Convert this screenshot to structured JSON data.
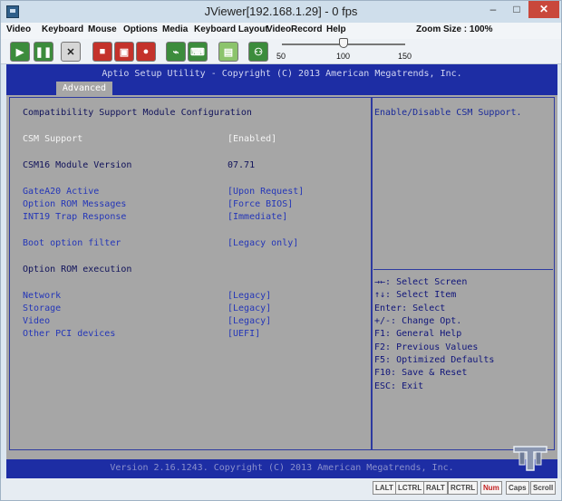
{
  "window": {
    "title": "JViewer[192.168.1.29] - 0 fps",
    "minimize_glyph": "–",
    "maximize_glyph": "□",
    "close_glyph": "✕"
  },
  "menubar": {
    "items": [
      "Video",
      "Keyboard",
      "Mouse",
      "Options",
      "Media",
      "Keyboard Layout",
      "VideoRecord",
      "Help"
    ],
    "zoom_label": "Zoom Size : 100%"
  },
  "toolbar": {
    "buttons": [
      {
        "icon": "play-icon",
        "color": "#3c8c3c"
      },
      {
        "icon": "pause-icon",
        "color": "#3c8c3c"
      },
      {
        "icon": "fullscreen-icon",
        "color": "#d6d6d6"
      },
      {
        "icon": "stop-icon",
        "color": "#c4322b"
      },
      {
        "icon": "save-icon",
        "color": "#c4322b"
      },
      {
        "icon": "record-icon",
        "color": "#c4322b"
      },
      {
        "icon": "mouse-icon",
        "color": "#3c8c3c"
      },
      {
        "icon": "keyboard-icon",
        "color": "#3c8c3c"
      },
      {
        "icon": "media-icon",
        "color": "#8cc46c"
      },
      {
        "icon": "users-icon",
        "color": "#3c8c3c"
      }
    ],
    "slider": {
      "ticks": [
        "50",
        "100",
        "150"
      ],
      "value": 100
    }
  },
  "bios": {
    "header_title": "Aptio Setup Utility - Copyright (C) 2013 American Megatrends, Inc.",
    "active_tab": "Advanced",
    "section_title": "Compatibility Support Module Configuration",
    "rows": [
      {
        "label": "CSM Support",
        "value": "[Enabled]",
        "style": "white"
      },
      {
        "label": "CSM16 Module Version",
        "value": "07.71",
        "style": "dark"
      },
      {
        "label": "GateA20 Active",
        "value": "[Upon Request]",
        "style": "blue"
      },
      {
        "label": "Option ROM Messages",
        "value": "[Force BIOS]",
        "style": "blue"
      },
      {
        "label": "INT19 Trap Response",
        "value": "[Immediate]",
        "style": "blue"
      },
      {
        "label": "Boot option filter",
        "value": "[Legacy only]",
        "style": "blue"
      },
      {
        "label": "Option ROM execution",
        "value": "",
        "style": "dark"
      },
      {
        "label": "Network",
        "value": "[Legacy]",
        "style": "blue"
      },
      {
        "label": "Storage",
        "value": "[Legacy]",
        "style": "blue"
      },
      {
        "label": "Video",
        "value": "[Legacy]",
        "style": "blue"
      },
      {
        "label": "Other PCI devices",
        "value": "[UEFI]",
        "style": "blue"
      }
    ],
    "help_text": "Enable/Disable CSM Support.",
    "key_help": [
      "→←: Select Screen",
      "↑↓: Select Item",
      "Enter: Select",
      "+/-: Change Opt.",
      "F1: General Help",
      "F2: Previous Values",
      "F5: Optimized Defaults",
      "F10: Save & Reset",
      "ESC: Exit"
    ],
    "footer": "Version 2.16.1243. Copyright (C) 2013 American Megatrends, Inc."
  },
  "statusbar": {
    "keys": [
      "LALT",
      "LCTRL",
      "RALT",
      "RCTRL",
      "Num",
      "Caps",
      "Scroll"
    ],
    "active_key": "Num"
  }
}
